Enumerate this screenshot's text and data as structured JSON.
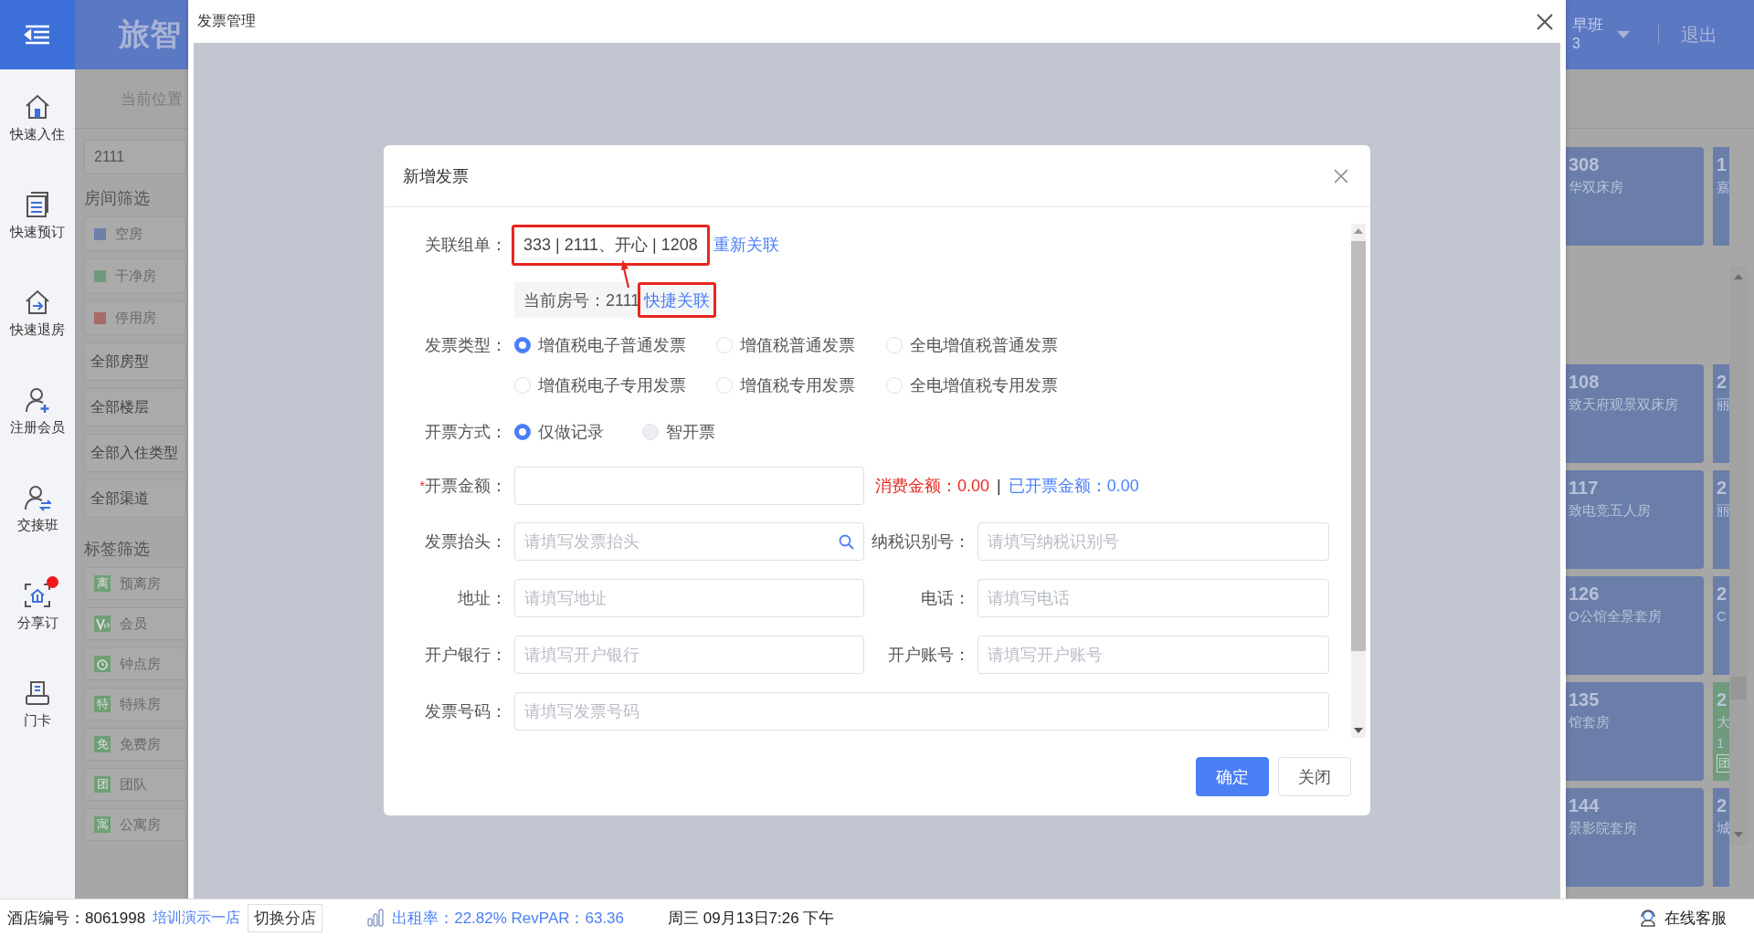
{
  "sidebar": {
    "items": [
      {
        "label": "快速入住",
        "badge": false
      },
      {
        "label": "快速预订",
        "badge": false
      },
      {
        "label": "快速退房",
        "badge": false
      },
      {
        "label": "注册会员",
        "badge": false
      },
      {
        "label": "交接班",
        "badge": false
      },
      {
        "label": "分享订",
        "badge": true
      },
      {
        "label": "门卡",
        "badge": false
      }
    ]
  },
  "header": {
    "logo": "旅智",
    "shift": "早班",
    "shift_sub": "3",
    "logout": "退出"
  },
  "breadcrumb": "当前位置",
  "filter_panel": {
    "search": "2111",
    "room_filter_title": "房间筛选",
    "room_states": [
      {
        "label": "空房",
        "color": "#6e7fa8"
      },
      {
        "label": "干净房",
        "color": "#6f9a7c"
      },
      {
        "label": "停用房",
        "color": "#a86a6a"
      }
    ],
    "dropdowns": [
      "全部房型",
      "全部楼层",
      "全部入住类型",
      "全部渠道"
    ],
    "tag_title": "标签筛选",
    "tags": [
      {
        "kind": "glyph",
        "glyph": "离",
        "label": "预离房"
      },
      {
        "kind": "vip",
        "label": "会员"
      },
      {
        "kind": "clock",
        "label": "钟点房"
      },
      {
        "kind": "glyph",
        "glyph": "特",
        "label": "特殊房"
      },
      {
        "kind": "glyph",
        "glyph": "免",
        "label": "免费房"
      },
      {
        "kind": "glyph",
        "glyph": "团",
        "label": "团队"
      },
      {
        "kind": "glyph",
        "glyph": "寓",
        "label": "公寓房"
      }
    ]
  },
  "room_rows": [
    {
      "cards": [
        {
          "number": "308",
          "name": "华双床房",
          "color": "#6a7ea9"
        },
        {
          "number": "1",
          "name": "嘉",
          "color": "#6a7ea9"
        }
      ]
    },
    {
      "cards": [
        {
          "number": "108",
          "name": "致天府观景双床房",
          "color": "#6a7ea9"
        },
        {
          "number": "2",
          "name": "丽",
          "color": "#6a7ea9"
        }
      ]
    },
    {
      "cards": [
        {
          "number": "117",
          "name": "致电竞五人房",
          "color": "#6a7ea9"
        },
        {
          "number": "2",
          "name": "丽",
          "color": "#6a7ea9"
        }
      ]
    },
    {
      "cards": [
        {
          "number": "126",
          "name": "O公馆全景套房",
          "color": "#6a7ea9"
        },
        {
          "number": "2",
          "name": "C",
          "color": "#6a7ea9"
        }
      ]
    },
    {
      "cards": [
        {
          "number": "135",
          "name": "馆套房",
          "color": "#6a7ea9"
        },
        {
          "number": "2",
          "name": "大",
          "color": "#6f9a7c",
          "extra": "1",
          "tag": "团"
        }
      ]
    },
    {
      "cards": [
        {
          "number": "144",
          "name": "景影院套房",
          "color": "#6a7ea9"
        },
        {
          "number": "2",
          "name": "城",
          "color": "#6a7ea9"
        }
      ]
    }
  ],
  "window": {
    "title": "发票管理"
  },
  "dialog": {
    "title": "新增发票",
    "linked_order": {
      "label": "关联组单：",
      "value": "333 | 2111、开心 | 1208",
      "relink": "重新关联"
    },
    "current_room": {
      "label": "当前房号：",
      "value": "2111",
      "quick_link": "快捷关联"
    },
    "invoice_type": {
      "label": "发票类型：",
      "options": [
        {
          "label": "增值税电子普通发票",
          "selected": true
        },
        {
          "label": "增值税普通发票",
          "selected": false
        },
        {
          "label": "全电增值税普通发票",
          "selected": false
        },
        {
          "label": "增值税电子专用发票",
          "selected": false
        },
        {
          "label": "增值税专用发票",
          "selected": false
        },
        {
          "label": "全电增值税专用发票",
          "selected": false
        }
      ]
    },
    "issue_method": {
      "label": "开票方式：",
      "options": [
        {
          "label": "仅做记录",
          "selected": true,
          "disabled": false
        },
        {
          "label": "智开票",
          "selected": false,
          "disabled": true
        }
      ]
    },
    "amount": {
      "label": "开票金额：",
      "required_mark": "*",
      "consumption": "消费金额：0.00",
      "separator": "|",
      "invoiced": "已开票金额：0.00"
    },
    "fields": [
      {
        "label": "发票抬头：",
        "placeholder": "请填写发票抬头",
        "search": true,
        "wide": false
      },
      {
        "label": "纳税识别号：",
        "placeholder": "请填写纳税识别号",
        "search": false,
        "wide": false
      },
      {
        "label": "地址：",
        "placeholder": "请填写地址",
        "search": false,
        "wide": false
      },
      {
        "label": "电话：",
        "placeholder": "请填写电话",
        "search": false,
        "wide": false
      },
      {
        "label": "开户银行：",
        "placeholder": "请填写开户银行",
        "search": false,
        "wide": false
      },
      {
        "label": "开户账号：",
        "placeholder": "请填写开户账号",
        "search": false,
        "wide": false
      },
      {
        "label": "发票号码：",
        "placeholder": "请填写发票号码",
        "search": false,
        "wide": true
      }
    ],
    "buttons": [
      {
        "label": "确定",
        "primary": true
      },
      {
        "label": "关闭",
        "primary": false
      }
    ]
  },
  "status_bar": {
    "hotel_no": "酒店编号：8061998",
    "hotel_name": "培训演示一店",
    "switch": "切换分店",
    "occupancy": "出租率：22.82% RevPAR：63.36",
    "datetime": "周三 09月13日7:26 下午",
    "support": "在线客服"
  }
}
